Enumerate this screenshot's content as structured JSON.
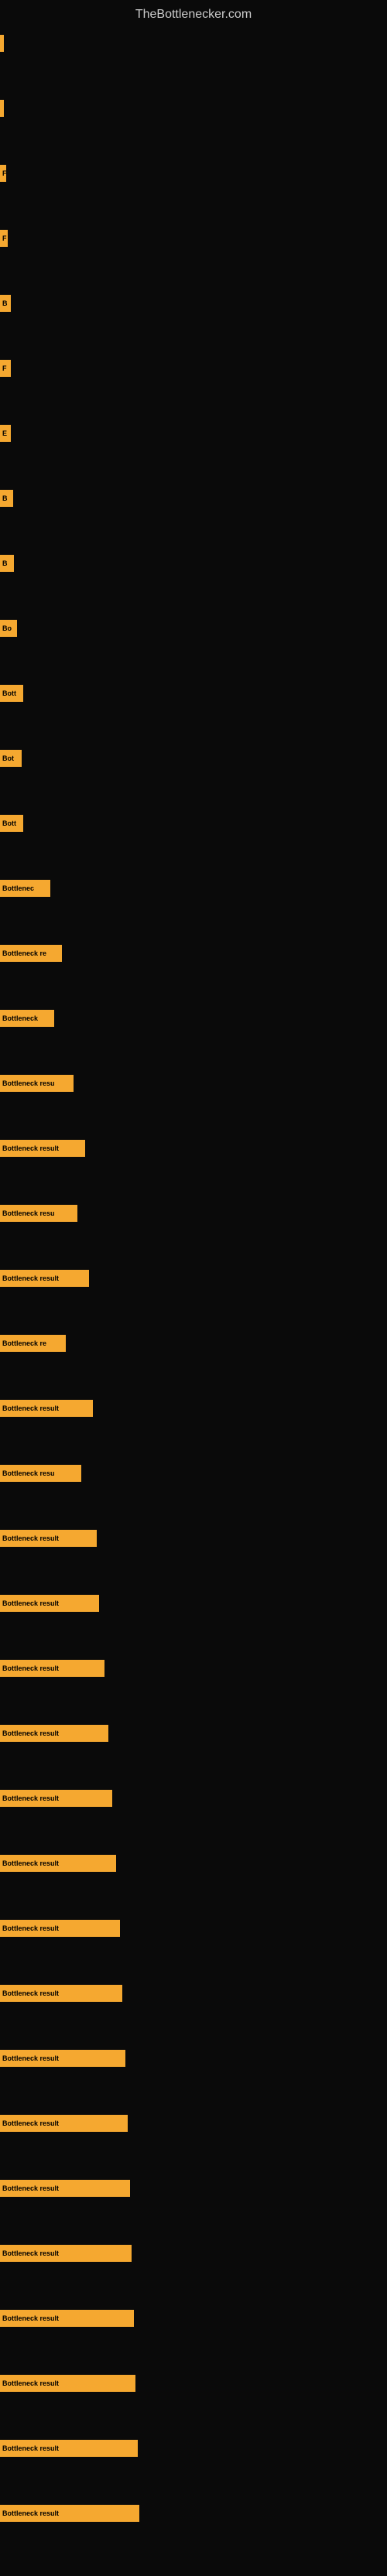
{
  "site": {
    "title": "TheBottlenecker.com"
  },
  "bars": [
    {
      "label": "",
      "width": 5
    },
    {
      "label": "",
      "width": 5
    },
    {
      "label": "F",
      "width": 8
    },
    {
      "label": "F",
      "width": 10
    },
    {
      "label": "B",
      "width": 14
    },
    {
      "label": "F",
      "width": 14
    },
    {
      "label": "E",
      "width": 14
    },
    {
      "label": "B",
      "width": 17
    },
    {
      "label": "B",
      "width": 18
    },
    {
      "label": "Bo",
      "width": 22
    },
    {
      "label": "Bott",
      "width": 30
    },
    {
      "label": "Bot",
      "width": 28
    },
    {
      "label": "Bott",
      "width": 30
    },
    {
      "label": "Bottlenec",
      "width": 65
    },
    {
      "label": "Bottleneck re",
      "width": 80
    },
    {
      "label": "Bottleneck",
      "width": 70
    },
    {
      "label": "Bottleneck resu",
      "width": 95
    },
    {
      "label": "Bottleneck result",
      "width": 110
    },
    {
      "label": "Bottleneck resu",
      "width": 100
    },
    {
      "label": "Bottleneck result",
      "width": 115
    },
    {
      "label": "Bottleneck re",
      "width": 85
    },
    {
      "label": "Bottleneck result",
      "width": 120
    },
    {
      "label": "Bottleneck resu",
      "width": 105
    },
    {
      "label": "Bottleneck result",
      "width": 125
    },
    {
      "label": "Bottleneck result",
      "width": 128
    },
    {
      "label": "Bottleneck result",
      "width": 135
    },
    {
      "label": "Bottleneck result",
      "width": 140
    },
    {
      "label": "Bottleneck result",
      "width": 145
    },
    {
      "label": "Bottleneck result",
      "width": 150
    },
    {
      "label": "Bottleneck result",
      "width": 155
    },
    {
      "label": "Bottleneck result",
      "width": 158
    },
    {
      "label": "Bottleneck result",
      "width": 162
    },
    {
      "label": "Bottleneck result",
      "width": 165
    },
    {
      "label": "Bottleneck result",
      "width": 168
    },
    {
      "label": "Bottleneck result",
      "width": 170
    },
    {
      "label": "Bottleneck result",
      "width": 173
    },
    {
      "label": "Bottleneck result",
      "width": 175
    },
    {
      "label": "Bottleneck result",
      "width": 178
    },
    {
      "label": "Bottleneck result",
      "width": 180
    }
  ],
  "colors": {
    "background": "#0a0a0a",
    "bar": "#f5a830",
    "title": "#cccccc"
  }
}
